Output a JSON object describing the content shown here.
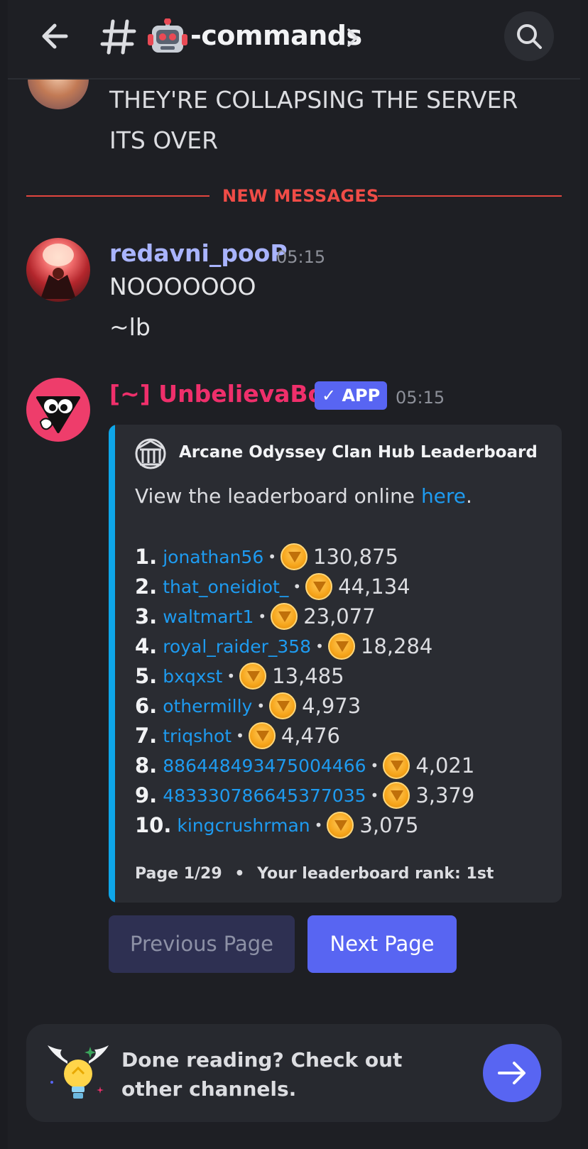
{
  "header": {
    "channel_emoji": "🤖",
    "channel_name": "-commands",
    "icons": [
      "back-arrow-icon",
      "hash-icon",
      "chevron-right-icon",
      "search-icon"
    ]
  },
  "previous_message": {
    "lines": [
      "THEY'RE COLLAPSING THE SERVER",
      "ITS OVER"
    ]
  },
  "divider": {
    "label": "NEW MESSAGES",
    "color": "#f04c47"
  },
  "message1": {
    "username": "redavni_pooP",
    "time": "05:15",
    "lines": [
      "NOOOOOOO",
      "~lb"
    ]
  },
  "bot_message": {
    "name": "[~] UnbelievaBoat",
    "badge": "✓ APP",
    "time": "05:15",
    "embed": {
      "title": "Arcane Odyssey Clan Hub Leaderboard",
      "desc_prefix": "View the leaderboard online ",
      "desc_link": "here",
      "desc_suffix": ".",
      "rows": [
        {
          "rank": "1.",
          "user": "jonathan56",
          "amount": "130,875"
        },
        {
          "rank": "2.",
          "user": "that_oneidiot_",
          "amount": "44,134"
        },
        {
          "rank": "3.",
          "user": "waltmart1",
          "amount": "23,077"
        },
        {
          "rank": "4.",
          "user": "royal_raider_358",
          "amount": "18,284"
        },
        {
          "rank": "5.",
          "user": "bxqxst",
          "amount": "13,485"
        },
        {
          "rank": "6.",
          "user": "othermilly",
          "amount": "4,973"
        },
        {
          "rank": "7.",
          "user": "triqshot",
          "amount": "4,476"
        },
        {
          "rank": "8.",
          "user": "886448493475004466",
          "amount": "4,021"
        },
        {
          "rank": "9.",
          "user": "483330786645377035",
          "amount": "3,379"
        },
        {
          "rank": "10.",
          "user": "kingcrushrman",
          "amount": "3,075"
        }
      ],
      "footer_page": "Page 1/29",
      "footer_sep": "•",
      "footer_rank": "Your leaderboard rank: 1st",
      "accent": "#0ea6e9"
    },
    "buttons": {
      "previous": "Previous Page",
      "next": "Next Page"
    }
  },
  "done_card": {
    "text": "Done reading? Check out other channels."
  }
}
